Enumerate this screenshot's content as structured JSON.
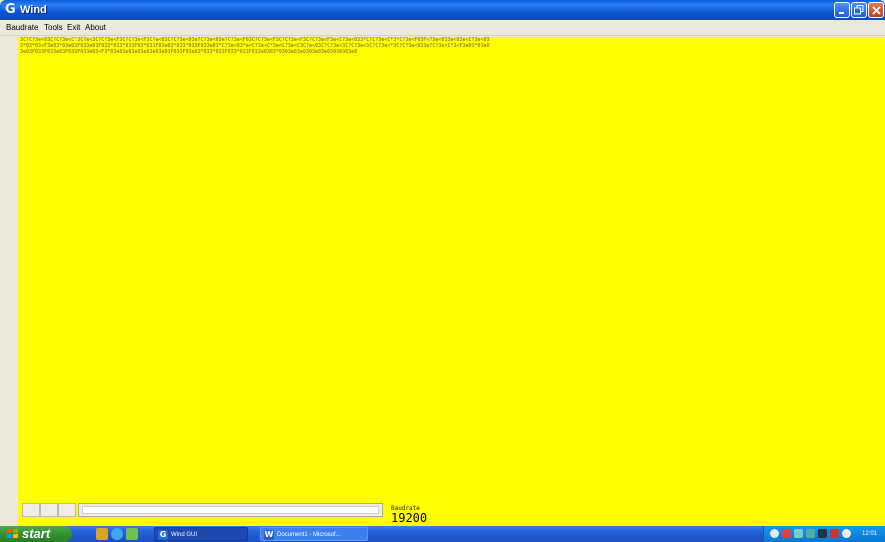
{
  "window": {
    "title": "Wind",
    "app_icon": "G",
    "controls": {
      "minimize": "minimize-icon",
      "maximize": "maximize-icon",
      "close": "close-icon"
    }
  },
  "menu": [
    {
      "label": "Baudrate"
    },
    {
      "label": "Tools"
    },
    {
      "label": "Exit"
    },
    {
      "label": "About"
    }
  ],
  "console": {
    "background": "#ffff00",
    "text": "3C?C?3e<03C?C?3e<C^3C?e<3C?C?3e<F3C?C?3e<F3C?e<03C?C?3e<03e?C?3e<03e?C?3e<F03C?C?3e<F3C?C?3e<F3C?C?3e<F3e<C?3e<033*C?C?3e<C*3*C?3e<F03F<?3e<033e<03e<C?3e<033*03*03<F3e03*03e03F033e03F033*033*033F03*033F03e03*033*033F033e03*C?3e<03*e<C?3e<C*3e<C?3e<C3C?e<03C?C?3e<3C?C?3e<3C?C?3e<*3C?C?3e<033e?C?3e<C*3<F3e03*03e03e03F033F033e03F033F033e03<F3*03e03e03e03e03e03e03F033F03e03*033*033F033*033F033e0303*0303e03e0303e03e03030303e0"
  },
  "status": {
    "baudrate_label": "Baudrate",
    "baudrate_value": "19200"
  },
  "taskbar": {
    "start_label": "start",
    "tasks": [
      {
        "label": "Wind GUI",
        "icon": "G"
      },
      {
        "label": "Document1 - Microsof...",
        "icon": "W"
      }
    ],
    "clock": "12:01"
  },
  "colors": {
    "titlebar": "#0a5fe0",
    "console_bg": "#ffff00",
    "console_text": "#9b8b1c",
    "taskbar": "#2562d8",
    "start": "#2f8d2c"
  }
}
